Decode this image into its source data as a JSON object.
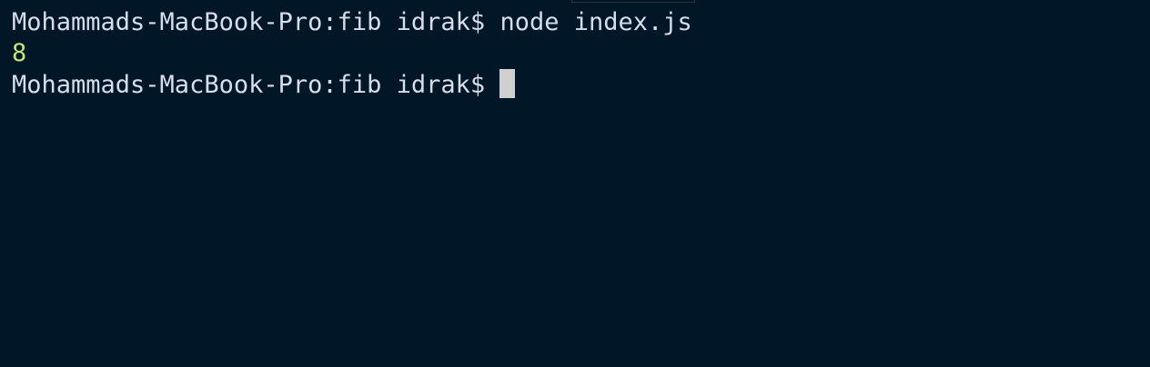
{
  "terminal": {
    "prompt": "Mohammads-MacBook-Pro:fib idrak$",
    "command": "node index.js",
    "output": "8",
    "current_prompt": "Mohammads-MacBook-Pro:fib idrak$"
  },
  "colors": {
    "background": "#011627",
    "text": "#d6deeb",
    "output": "#c5e478",
    "cursor": "#cfcfcf"
  }
}
